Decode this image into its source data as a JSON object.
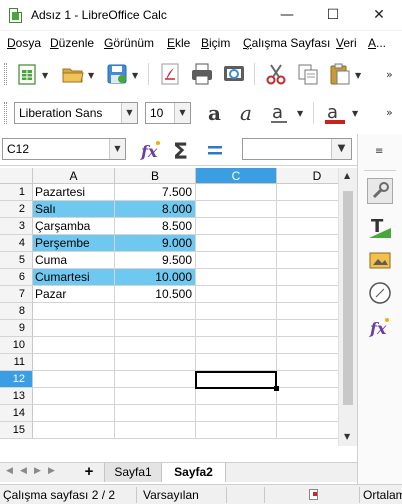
{
  "window": {
    "title": "Adsız 1 - LibreOffice Calc",
    "minimize_glyph": "—",
    "maximize_glyph": "☐",
    "close_glyph": "✕"
  },
  "menu": {
    "items": [
      {
        "ul": "D",
        "rest": "osya"
      },
      {
        "ul": "D",
        "rest": "üzenle"
      },
      {
        "ul": "G",
        "rest": "örünüm"
      },
      {
        "ul": "E",
        "rest": "kle"
      },
      {
        "ul": "B",
        "rest": "içim"
      },
      {
        "ul": "Ç",
        "rest": "alışma Sayfası"
      },
      {
        "ul": "V",
        "rest": "eri"
      },
      {
        "ul": "A",
        "rest": "..."
      }
    ]
  },
  "formatting": {
    "font_name": "Liberation Sans",
    "font_size": "10"
  },
  "formula": {
    "name_box": "C12",
    "content": ""
  },
  "columns": [
    "A",
    "B",
    "C",
    "D"
  ],
  "rows": [
    "1",
    "2",
    "3",
    "4",
    "5",
    "6",
    "7",
    "8",
    "9",
    "10",
    "11",
    "12",
    "13",
    "14",
    "15"
  ],
  "table": [
    {
      "day": "Pazartesi",
      "value": "7.500",
      "highlight": false
    },
    {
      "day": "Salı",
      "value": "8.000",
      "highlight": true
    },
    {
      "day": "Çarşamba",
      "value": "8.500",
      "highlight": false
    },
    {
      "day": "Perşembe",
      "value": "9.000",
      "highlight": true
    },
    {
      "day": "Cuma",
      "value": "9.500",
      "highlight": false
    },
    {
      "day": "Cumartesi",
      "value": "10.000",
      "highlight": true
    },
    {
      "day": "Pazar",
      "value": "10.500",
      "highlight": false
    }
  ],
  "selection": {
    "column": "C",
    "row": "12"
  },
  "sheets": {
    "add_label": "+",
    "tabs": [
      {
        "label": "Sayfa1",
        "active": false
      },
      {
        "label": "Sayfa2",
        "active": true
      }
    ]
  },
  "status": {
    "sheet_info": "Çalışma sayfası 2 / 2",
    "page_style": "Varsayılan",
    "right_text": "Ortalam"
  },
  "colors": {
    "highlight": "#6fc8ef",
    "selection_header": "#3b9ee2"
  }
}
